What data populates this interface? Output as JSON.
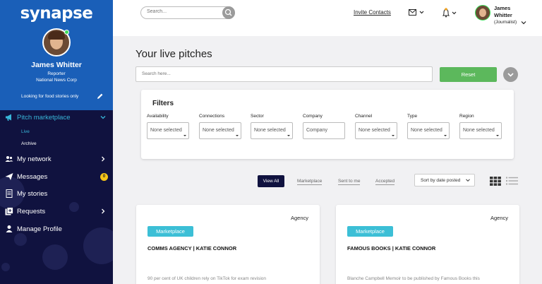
{
  "sidebar": {
    "logo": "synapse",
    "user": {
      "name": "James Whitter",
      "role": "Reporter",
      "organisation": "National News Corp",
      "status": "Looking for food stories only"
    },
    "nav": {
      "pitch_marketplace": "Pitch marketplace",
      "sub_live": "Live",
      "sub_archive": "Archive",
      "my_network": "My network",
      "messages": "Messages",
      "messages_badge": "0",
      "my_stories": "My stories",
      "requests": "Requests",
      "manage_profile": "Manage Profile"
    },
    "colors": {
      "top": "#1a5fb8",
      "bottom": "#10123f",
      "active": "#38b6d9"
    }
  },
  "header": {
    "search_placeholder": "Search...",
    "invite_contacts": "Invite Contacts",
    "user_first": "James",
    "user_last": "Whitter",
    "user_role": "(Journalist)"
  },
  "main": {
    "title": "Your live pitches",
    "search_placeholder": "Search here...",
    "reset_label": "Reset",
    "filters": {
      "title": "Filters",
      "items": [
        {
          "label": "Availability",
          "value": "None selected"
        },
        {
          "label": "Connections",
          "value": "None selected"
        },
        {
          "label": "Sector",
          "value": "None selected"
        },
        {
          "label": "Company",
          "value": "Company"
        },
        {
          "label": "Channel",
          "value": "None selected"
        },
        {
          "label": "Type",
          "value": "None selected"
        },
        {
          "label": "Region",
          "value": "None selected"
        }
      ]
    },
    "tabs": {
      "view_all": "View All",
      "marketplace": "Marketplace",
      "sent_to_me": "Sent to me",
      "accepted": "Accepted"
    },
    "sort_label": "Sort by date posted",
    "cards": [
      {
        "type": "Agency",
        "tag": "Marketplace",
        "title": "COMMS AGENCY | KATIE CONNOR",
        "snippet": "90 per cent of UK children rely on TikTok for exam revision"
      },
      {
        "type": "Agency",
        "tag": "Marketplace",
        "title": "FAMOUS BOOKS | KATIE CONNOR",
        "snippet": "Blanche Campbell Memoir to be published by Famous Books this"
      }
    ]
  }
}
